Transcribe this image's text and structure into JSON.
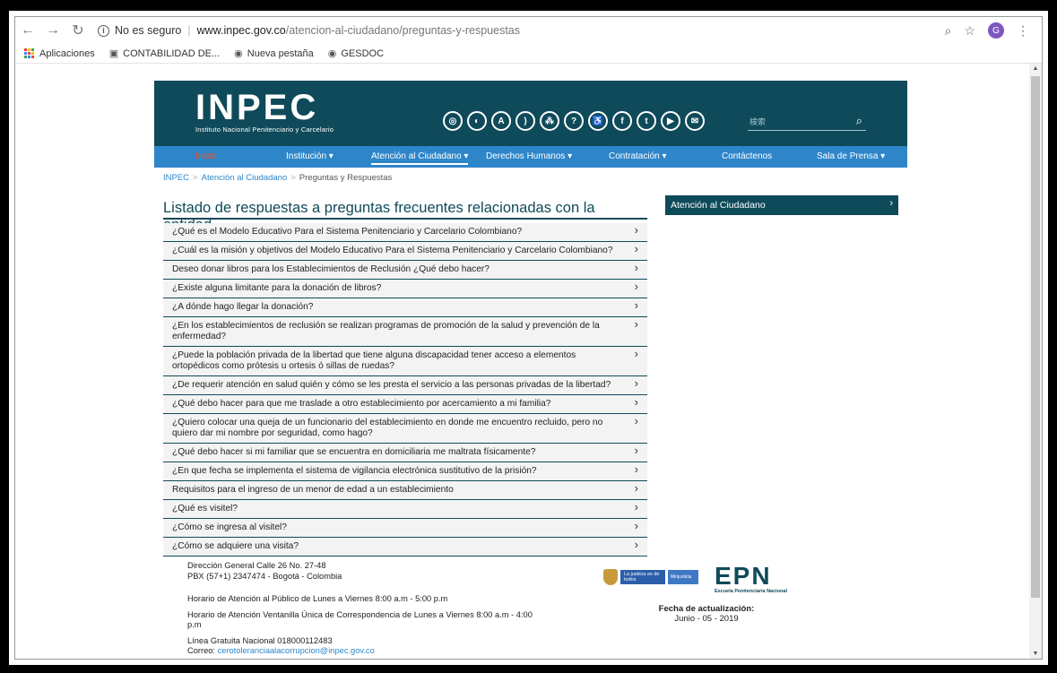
{
  "browser": {
    "security_label": "No es seguro",
    "url_host": "www.inpec.gov.co",
    "url_path": "/atencion-al-ciudadano/preguntas-y-respuestas",
    "profile_initial": "G",
    "bookmarks": [
      "Aplicaciones",
      "CONTABILIDAD DE...",
      "Nueva pestaña",
      "GESDOC"
    ]
  },
  "header": {
    "logo_text": "INPEC",
    "logo_subtitle": "Instituto Nacional Penitenciario y Carcelario",
    "search_placeholder": "検索",
    "social_icons": [
      "globe-icon",
      "contrast-icon",
      "font-size-icon",
      "rss-icon",
      "sitemap-icon",
      "help-icon",
      "accessibility-icon",
      "facebook-icon",
      "twitter-icon",
      "youtube-icon",
      "mail-icon"
    ]
  },
  "nav": {
    "items": [
      "Inicio",
      "Institución ▾",
      "Atención al Ciudadano ▾",
      "Derechos Humanos ▾",
      "Contratación ▾",
      "Contáctenos",
      "Sala de Prensa ▾"
    ]
  },
  "breadcrumb": {
    "items": [
      "INPEC",
      "Atención al Ciudadano",
      "Preguntas y Respuestas"
    ]
  },
  "main": {
    "title": "Listado de respuestas a preguntas frecuentes relacionadas con la entidad",
    "faqs": [
      "¿Qué es el Modelo Educativo Para el Sistema Penitenciario y Carcelario Colombiano?",
      "¿Cuál es la misión y objetivos del Modelo Educativo Para el Sistema Penitenciario y Carcelario Colombiano?",
      "Deseo donar libros para los Establecimientos de Reclusión ¿Qué debo hacer?",
      "¿Existe alguna limitante para la donación de libros?",
      "¿A dónde hago llegar la donación?",
      "¿En los establecimientos de reclusión se realizan programas de promoción de la salud y prevención de la enfermedad?",
      "¿Puede la población privada de la libertad que tiene alguna discapacidad tener acceso a elementos ortopédicos como prótesis u ortesis ó sillas de ruedas?",
      "¿De requerir atención en salud quién y cómo se les presta el servicio a las personas privadas de la libertad?",
      "¿Qué debo hacer para que me traslade a otro establecimiento por acercamiento a mi familia?",
      "¿Quiero colocar una queja de un funcionario del establecimiento en donde me encuentro recluido, pero no quiero dar mi nombre por seguridad, como hago?",
      "¿Qué debo hacer si mi familiar que se encuentra en domiciliaria me maltrata físicamente?",
      "¿En que fecha se implementa el sistema de vigilancia electrónica sustitutivo de la prisión?",
      "Requisitos para el ingreso de un menor de edad a un establecimiento",
      "¿Qué es visitel?",
      "¿Cómo se ingresa al visitel?",
      "¿Cómo se adquiere una visita?"
    ]
  },
  "sidebar": {
    "panel_label": "Atención al Ciudadano"
  },
  "footer": {
    "address": "Dirección General Calle 26 No. 27-48",
    "phone": "PBX (57+1) 2347474 - Bogotá - Colombia",
    "hours_public": "Horario de Atención al Público de Lunes a Viernes 8:00 a.m - 5:00 p.m",
    "hours_window": "Horario de Atención Ventanilla Única de Correspondencia de Lunes a Viernes 8:00 a.m - 4:00 p.m",
    "toll_free": "Línea Gratuita Nacional 018000112483",
    "email_label": "Correo: ",
    "email": "cerotoleranciaalacorrupcion@inpec.gov.co",
    "ministry_text_1": "La justicia es de todos",
    "ministry_text_2": "Minjusticia",
    "epn_logo": "EPN",
    "epn_subtitle": "Escuela Penitenciaria Nacional",
    "update_label": "Fecha de actualización:",
    "update_date": "Junio - 05 - 2019"
  }
}
